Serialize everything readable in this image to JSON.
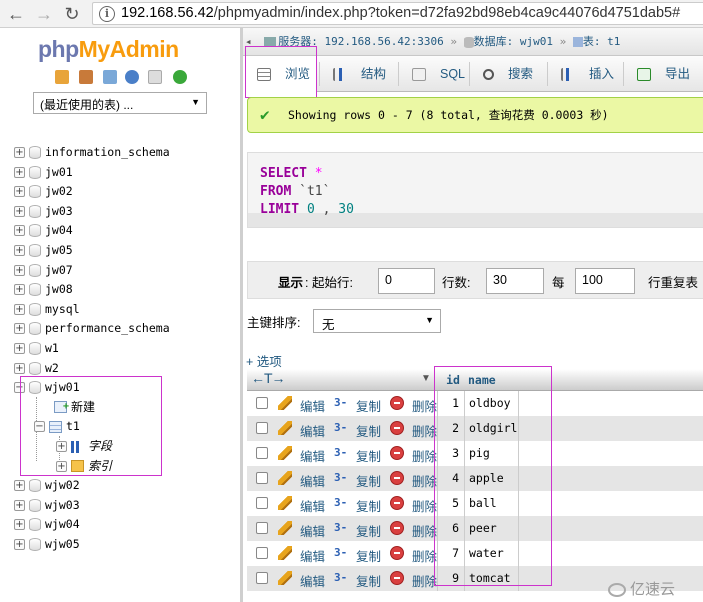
{
  "browser": {
    "url_host": "192.168.56.42",
    "url_path": "/phpmyadmin/index.php?token=d72fa92bd98eb4ca9c44076d4751dab5#"
  },
  "sidebar": {
    "logo_php": "php",
    "logo_myadmin": "MyAdmin",
    "recent_select": "(最近使用的表) ...",
    "databases": [
      {
        "name": "information_schema"
      },
      {
        "name": "jw01"
      },
      {
        "name": "jw02"
      },
      {
        "name": "jw03"
      },
      {
        "name": "jw04"
      },
      {
        "name": "jw05"
      },
      {
        "name": "jw07"
      },
      {
        "name": "jw08"
      },
      {
        "name": "mysql"
      },
      {
        "name": "performance_schema"
      },
      {
        "name": "w1"
      },
      {
        "name": "w2"
      },
      {
        "name": "wjw01"
      },
      {
        "name": "wjw02"
      },
      {
        "name": "wjw03"
      },
      {
        "name": "wjw04"
      },
      {
        "name": "wjw05"
      }
    ],
    "expanded": {
      "new_label": "新建",
      "table_name": "t1",
      "columns_label": "字段",
      "indexes_label": "索引"
    }
  },
  "breadcrumb": {
    "server_label": "服务器:",
    "server_value": "192.168.56.42:3306",
    "db_label": "数据库:",
    "db_value": "wjw01",
    "table_label": "表:",
    "table_value": "t1"
  },
  "tabs": [
    {
      "label": "浏览",
      "active": true
    },
    {
      "label": "结构",
      "active": false
    },
    {
      "label": "SQL",
      "active": false
    },
    {
      "label": "搜索",
      "active": false
    },
    {
      "label": "插入",
      "active": false
    },
    {
      "label": "导出",
      "active": false
    }
  ],
  "message": "Showing rows 0 - 7 (8 total, 查询花费 0.0003 秒)",
  "sql": {
    "select_kw": "SELECT",
    "star": "*",
    "from_kw": "FROM",
    "table_ident": "`t1`",
    "limit_kw": "LIMIT",
    "limit_a": "0",
    "limit_sep": ",",
    "limit_b": "30"
  },
  "navigation": {
    "show_label": "显示",
    "start_label": ": 起始行:",
    "start_value": "0",
    "rows_label": "行数:",
    "rows_value": "30",
    "every_label": "每",
    "every_value": "100",
    "repeat_label": "行重复表"
  },
  "sort": {
    "label": "主键排序:",
    "value": "无"
  },
  "options_link": "+ 选项",
  "table": {
    "headers": {
      "id": "id",
      "name": "name"
    },
    "action_labels": {
      "edit": "编辑",
      "copy": "复制",
      "delete": "删除"
    },
    "rows": [
      {
        "id": "1",
        "name": "oldboy"
      },
      {
        "id": "2",
        "name": "oldgirl"
      },
      {
        "id": "3",
        "name": "pig"
      },
      {
        "id": "4",
        "name": "apple"
      },
      {
        "id": "5",
        "name": "ball"
      },
      {
        "id": "6",
        "name": "peer"
      },
      {
        "id": "7",
        "name": "water"
      },
      {
        "id": "9",
        "name": "tomcat"
      }
    ]
  },
  "watermark": "亿速云",
  "colors": {
    "link": "#235a81",
    "success_bg": "#ebf8a4",
    "highlight": "#cc33cc",
    "keyword": "#990099"
  }
}
